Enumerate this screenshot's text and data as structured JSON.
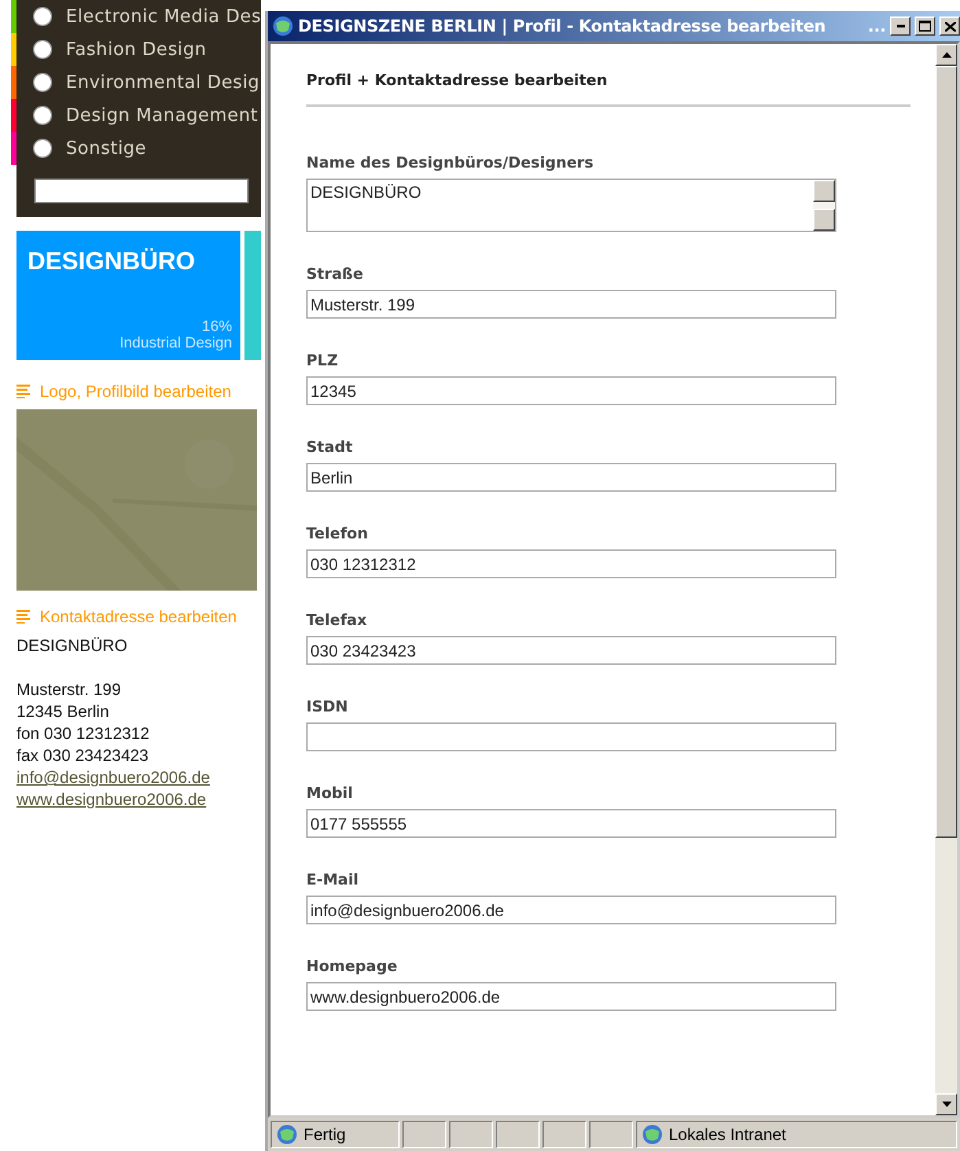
{
  "sidebar": {
    "categories": [
      {
        "label": "Electronic Media Des",
        "color": "#66cc00",
        "selected": false
      },
      {
        "label": "Fashion Design",
        "color": "#ffcc00",
        "selected": false
      },
      {
        "label": "Environmental Desig",
        "color": "#ff6600",
        "selected": false
      },
      {
        "label": "Design Management",
        "color": "#ff0033",
        "selected": false
      },
      {
        "label": "Sonstige",
        "color": "#ff0099",
        "selected": false
      }
    ],
    "profile_tile": {
      "name": "DESIGNBÜRO",
      "percent": "16%",
      "category": "Industrial Design"
    },
    "logo_link": "Logo, Profilbild bearbeiten",
    "contact_link": "Kontaktadresse bearbeiten",
    "address_name": "DESIGNBÜRO",
    "address_lines": [
      "Musterstr. 199",
      "12345 Berlin",
      "fon 030 12312312",
      "fax 030 23423423"
    ],
    "email_link": "info@designbuero2006.de",
    "web_link": "www.designbuero2006.de"
  },
  "window": {
    "title": "DESIGNSZENE BERLIN | Profil - Kontaktadresse bearbeiten",
    "title_overflow": "..."
  },
  "heading": "Profil + Kontaktadresse bearbeiten",
  "fields": [
    {
      "kind": "textarea",
      "label": "Name des Designbüros/Designers",
      "value": "DESIGNBÜRO"
    },
    {
      "kind": "input",
      "label": "Straße",
      "value": "Musterstr. 199"
    },
    {
      "kind": "input",
      "label": "PLZ",
      "value": "12345"
    },
    {
      "kind": "input",
      "label": "Stadt",
      "value": "Berlin"
    },
    {
      "kind": "input",
      "label": "Telefon",
      "value": "030 12312312"
    },
    {
      "kind": "input",
      "label": "Telefax",
      "value": "030 23423423"
    },
    {
      "kind": "input",
      "label": "ISDN"
    },
    {
      "kind": "input",
      "label": "Mobil",
      "value": "0177 555555"
    },
    {
      "kind": "input",
      "label": "E-Mail",
      "value": "info@designbuero2006.de"
    },
    {
      "kind": "input",
      "label": "Homepage",
      "value": "www.designbuero2006.de"
    }
  ],
  "status_bar": {
    "status": "Fertig",
    "zone": "Lokales Intranet"
  }
}
